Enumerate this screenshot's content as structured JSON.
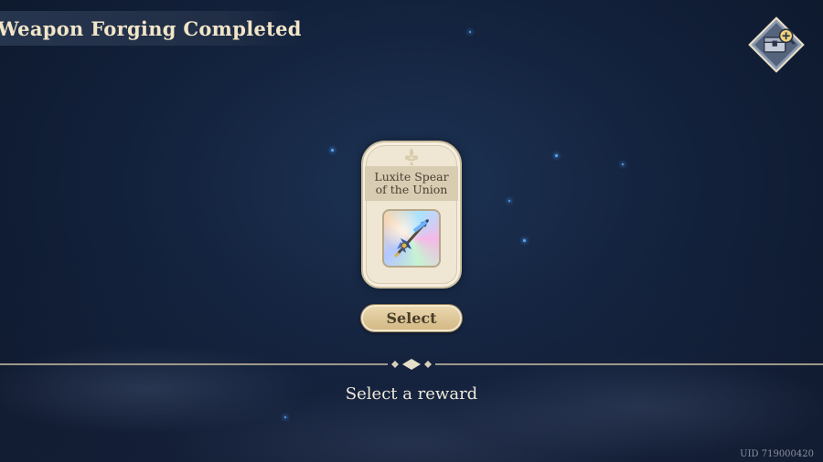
{
  "header": {
    "title": "Weapon Forging Completed"
  },
  "toolbar": {
    "inventory_icon": "chest-magnify-icon"
  },
  "reward_card": {
    "name": "Luxite Spear of the Union",
    "icon": "spear-icon"
  },
  "select_button": {
    "label": "Select"
  },
  "prompt": "Select a reward",
  "footer": {
    "uid": "UID 719000420"
  },
  "colors": {
    "accent": "#e2cc9b",
    "title_text": "#f2e6c8",
    "background": "#13223d"
  }
}
